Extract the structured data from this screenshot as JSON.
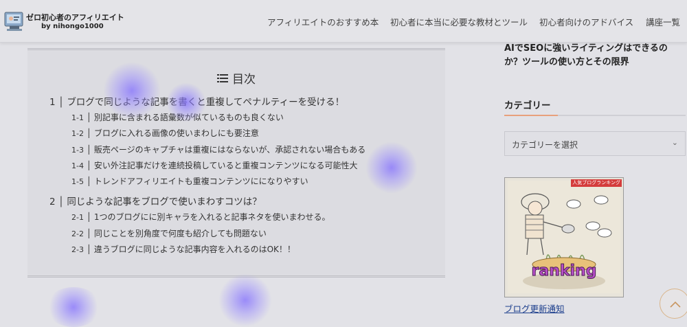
{
  "header": {
    "site_title": "ゼロ初心者のアフィリエイト",
    "site_subtitle": "by nihongo1000",
    "nav": [
      "アフィリエイトのおすすめ本",
      "初心者に本当に必要な教材とツール",
      "初心者向けのアドバイス",
      "講座一覧"
    ]
  },
  "toc": {
    "title": "目次",
    "sections": [
      {
        "number": "1",
        "label": "ブログで同じような記事を書くと重複してペナルティーを受ける！",
        "items": [
          {
            "number": "1-1",
            "label": "別記事に含まれる語彙数が似ているものも良くない"
          },
          {
            "number": "1-2",
            "label": "ブログに入れる画像の使いまわしにも要注意"
          },
          {
            "number": "1-3",
            "label": "販売ページのキャプチャは重複にはならないが、承認されない場合もある"
          },
          {
            "number": "1-4",
            "label": "安い外注記事だけを連続投稿していると重複コンテンツになる可能性大"
          },
          {
            "number": "1-5",
            "label": "トレンドアフィリエイトも重複コンテンツにになりやすい"
          }
        ]
      },
      {
        "number": "2",
        "label": "同じような記事をブログで使いまわすコツは？",
        "items": [
          {
            "number": "2-1",
            "label": "1つのブログにに別キャラを入れると記事ネタを使いまわせる。"
          },
          {
            "number": "2-2",
            "label": "同じことを別角度で何度も紹介しても問題ない"
          },
          {
            "number": "2-3",
            "label": "違うブログに同じような記事内容を入れるのはOK！！"
          }
        ]
      }
    ]
  },
  "sidebar": {
    "article_title": "AIでSEOに強いライティングはできるのか？ツールの使い方とその限界",
    "category_heading": "カテゴリー",
    "category_select_value": "カテゴリーを選択",
    "banner_tag": "人気ブログランキング",
    "banner_text": "ranking",
    "update_link": "ブログ更新通知"
  },
  "icons": {
    "toc": "list-icon",
    "dropdown": "chevron-down-icon",
    "scroll_top": "chevron-up-icon"
  },
  "colors": {
    "accent": "#e8a07c",
    "link": "#1b3d8c",
    "ad_blob": "#8a78ff"
  }
}
